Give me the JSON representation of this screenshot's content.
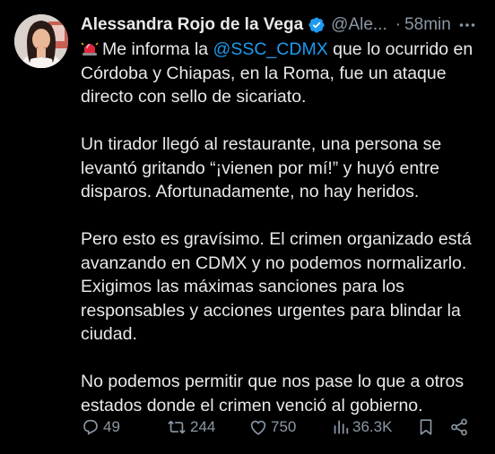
{
  "author": {
    "name": "Alessandra Rojo de la Vega",
    "handle": "@Ale...",
    "separator": "·",
    "time": "58min",
    "more_icon": "more-horizontal-icon",
    "verified_color": "#1d9bf0"
  },
  "tweet": {
    "p1_pre": "Me informa la ",
    "p1_mention": "@SSC_CDMX",
    "p1_post": " que lo ocurrido en Córdoba y Chiapas, en la Roma, fue un ataque directo con sello de sicariato.",
    "p2": "Un tirador llegó al restaurante, una persona se levantó gritando “¡vienen por mí!” y huyó entre disparos. Afortunadamente, no hay heridos.",
    "p3": "Pero esto es gravísimo. El crimen organizado está avanzando en CDMX y no podemos normalizarlo. Exigimos las máximas sanciones para los responsables y acciones urgentes para blindar la ciudad.",
    "p4": "No podemos permitir que nos pase lo que a otros estados donde el crimen venció al gobierno.",
    "emoji": "siren-emoji"
  },
  "actions": {
    "replies": "49",
    "reposts": "244",
    "likes": "750",
    "views": "36.3K"
  },
  "colors": {
    "background": "#000000",
    "text": "#e7e9ea",
    "secondary": "#8b98a5",
    "accent": "#1d9bf0",
    "repost_green": "#8b98a5"
  }
}
